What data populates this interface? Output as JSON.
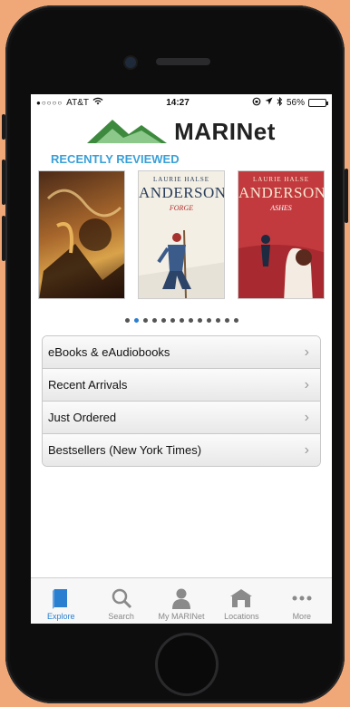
{
  "status": {
    "carrier": "AT&T",
    "signal_dots": "●○○○○",
    "time": "14:27",
    "battery": "56%",
    "battery_level": 0.56
  },
  "app": {
    "brand": "MARINet",
    "section_title": "RECENTLY REVIEWED"
  },
  "books": [
    {
      "author_small": "",
      "author_big": "",
      "title": ""
    },
    {
      "author_small": "LAURIE HALSE",
      "author_big": "ANDERSON",
      "title": "FORGE"
    },
    {
      "author_small": "LAURIE HALSE",
      "author_big": "ANDERSON",
      "title": "ASHES"
    }
  ],
  "pager": {
    "count": 13,
    "active": 1
  },
  "menu": [
    {
      "label": "eBooks & eAudiobooks"
    },
    {
      "label": "Recent Arrivals"
    },
    {
      "label": "Just Ordered"
    },
    {
      "label": "Bestsellers (New York Times)"
    }
  ],
  "tabs": [
    {
      "label": "Explore",
      "icon": "book-icon",
      "active": true
    },
    {
      "label": "Search",
      "icon": "search-icon",
      "active": false
    },
    {
      "label": "My MARINet",
      "icon": "user-icon",
      "active": false
    },
    {
      "label": "Locations",
      "icon": "building-icon",
      "active": false
    },
    {
      "label": "More",
      "icon": "more-icon",
      "active": false
    }
  ],
  "colors": {
    "accent": "#2a7fd0",
    "section_title": "#3aa0d8",
    "logo_green_dark": "#3d8a3e",
    "logo_green_light": "#8cc88a"
  }
}
